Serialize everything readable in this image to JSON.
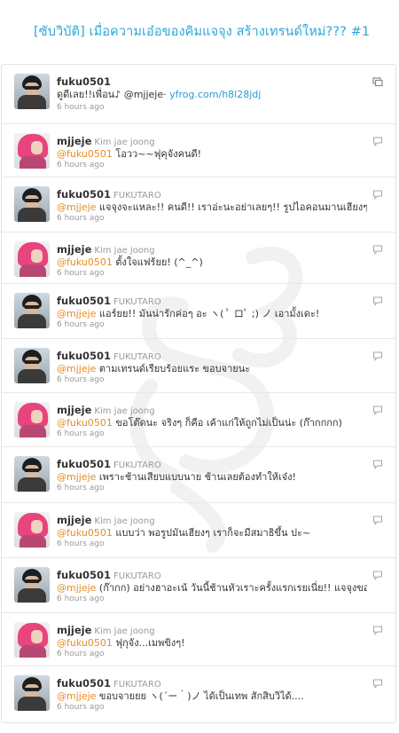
{
  "page": {
    "title": "[ซับวิบัติ] เมื่อความเอ๋อของคิมแจจุง สร้างเทรนด์ใหม่??? #1"
  },
  "tweets": [
    {
      "username": "fuku0501",
      "fullname": "",
      "avatar": "fuku",
      "mention": "",
      "text": "ดูดีเลย!!เพื่อน♪ @mjjeje· ",
      "link": "yfrog.com/h8l28jdj",
      "time": "6 hours ago",
      "icon": "retweet-icon"
    },
    {
      "username": "mjjeje",
      "fullname": "Kim jae joong",
      "avatar": "mj",
      "mention": "@fuku0501",
      "text": " โอวว~~ฟุคุจังคนดี!",
      "link": "",
      "time": "6 hours ago",
      "icon": "reply-icon"
    },
    {
      "username": "fuku0501",
      "fullname": "FUKUTARO",
      "avatar": "fuku",
      "mention": "@mjjeje",
      "text": " แจจุงจะแหละ!! คนดี!! เราอ่ะนะอย่าเลยๆ!! รูปไอคอนมานเฮียงๆ ปะ....",
      "link": "",
      "time": "6 hours ago",
      "icon": "reply-icon"
    },
    {
      "username": "mjjeje",
      "fullname": "Kim jae joong",
      "avatar": "mj",
      "mention": "@fuku0501",
      "text": " ตั้งใจแฟร้ยย! (^_^)",
      "link": "",
      "time": "6 hours ago",
      "icon": "reply-icon"
    },
    {
      "username": "fuku0501",
      "fullname": "FUKUTARO",
      "avatar": "fuku",
      "mention": "@mjjeje",
      "text": " แอร์ยย!! มันน่ารักค่อๆ อะ ヽ( ﾟ ロﾟ ;) ノ เอามั้งเดะ!",
      "link": "",
      "time": "6 hours ago",
      "icon": "reply-icon"
    },
    {
      "username": "fuku0501",
      "fullname": "FUKUTARO",
      "avatar": "fuku",
      "mention": "@mjjeje",
      "text": " ตามเทรนด์เรียบร้อยแระ ขอบจายนะ",
      "link": "",
      "time": "6 hours ago",
      "icon": "reply-icon"
    },
    {
      "username": "mjjeje",
      "fullname": "Kim jae joong",
      "avatar": "mj",
      "mention": "@fuku0501",
      "text": " ขอโต๊ดนะ จริงๆ ก็คือ เค้าแก่ให้ถูกไม่เป็นน่ะ (ก๊ากกกก)",
      "link": "",
      "time": "6 hours ago",
      "icon": "reply-icon"
    },
    {
      "username": "fuku0501",
      "fullname": "FUKUTARO",
      "avatar": "fuku",
      "mention": "@mjjeje",
      "text": " เพราะช้านเสียบแบบนาย ช้านเลยต้องทำให้เจ๋ง!",
      "link": "",
      "time": "6 hours ago",
      "icon": "reply-icon"
    },
    {
      "username": "mjjeje",
      "fullname": "Kim jae joong",
      "avatar": "mj",
      "mention": "@fuku0501",
      "text": " แบบว่า พอรูปมันเฮียงๆ เราก็จะมีสมาธิขึ้น    ปะ~",
      "link": "",
      "time": "6 hours ago",
      "icon": "reply-icon"
    },
    {
      "username": "fuku0501",
      "fullname": "FUKUTARO",
      "avatar": "fuku",
      "mention": "@mjjeje",
      "text": " (ก๊ากก) อย่างฮาอะเน้ วันนี้ช้านหัวเราะครั้งแรกเรยเนี่ย!! แจจุงขอบคุณน้า",
      "link": "",
      "time": "6 hours ago",
      "icon": "reply-icon"
    },
    {
      "username": "mjjeje",
      "fullname": "Kim jae joong",
      "avatar": "mj",
      "mention": "@fuku0501",
      "text": " ฟุกุจัง...เมพขิงๆ!",
      "link": "",
      "time": "6 hours ago",
      "icon": "reply-icon"
    },
    {
      "username": "fuku0501",
      "fullname": "FUKUTARO",
      "avatar": "fuku",
      "mention": "@mjjeje",
      "text": " ขอบจายยย ヽ(´ー｀)ノ ได้เป็นเทพ สักสิบวิได้....",
      "link": "",
      "time": "6 hours ago",
      "icon": "reply-icon"
    }
  ]
}
